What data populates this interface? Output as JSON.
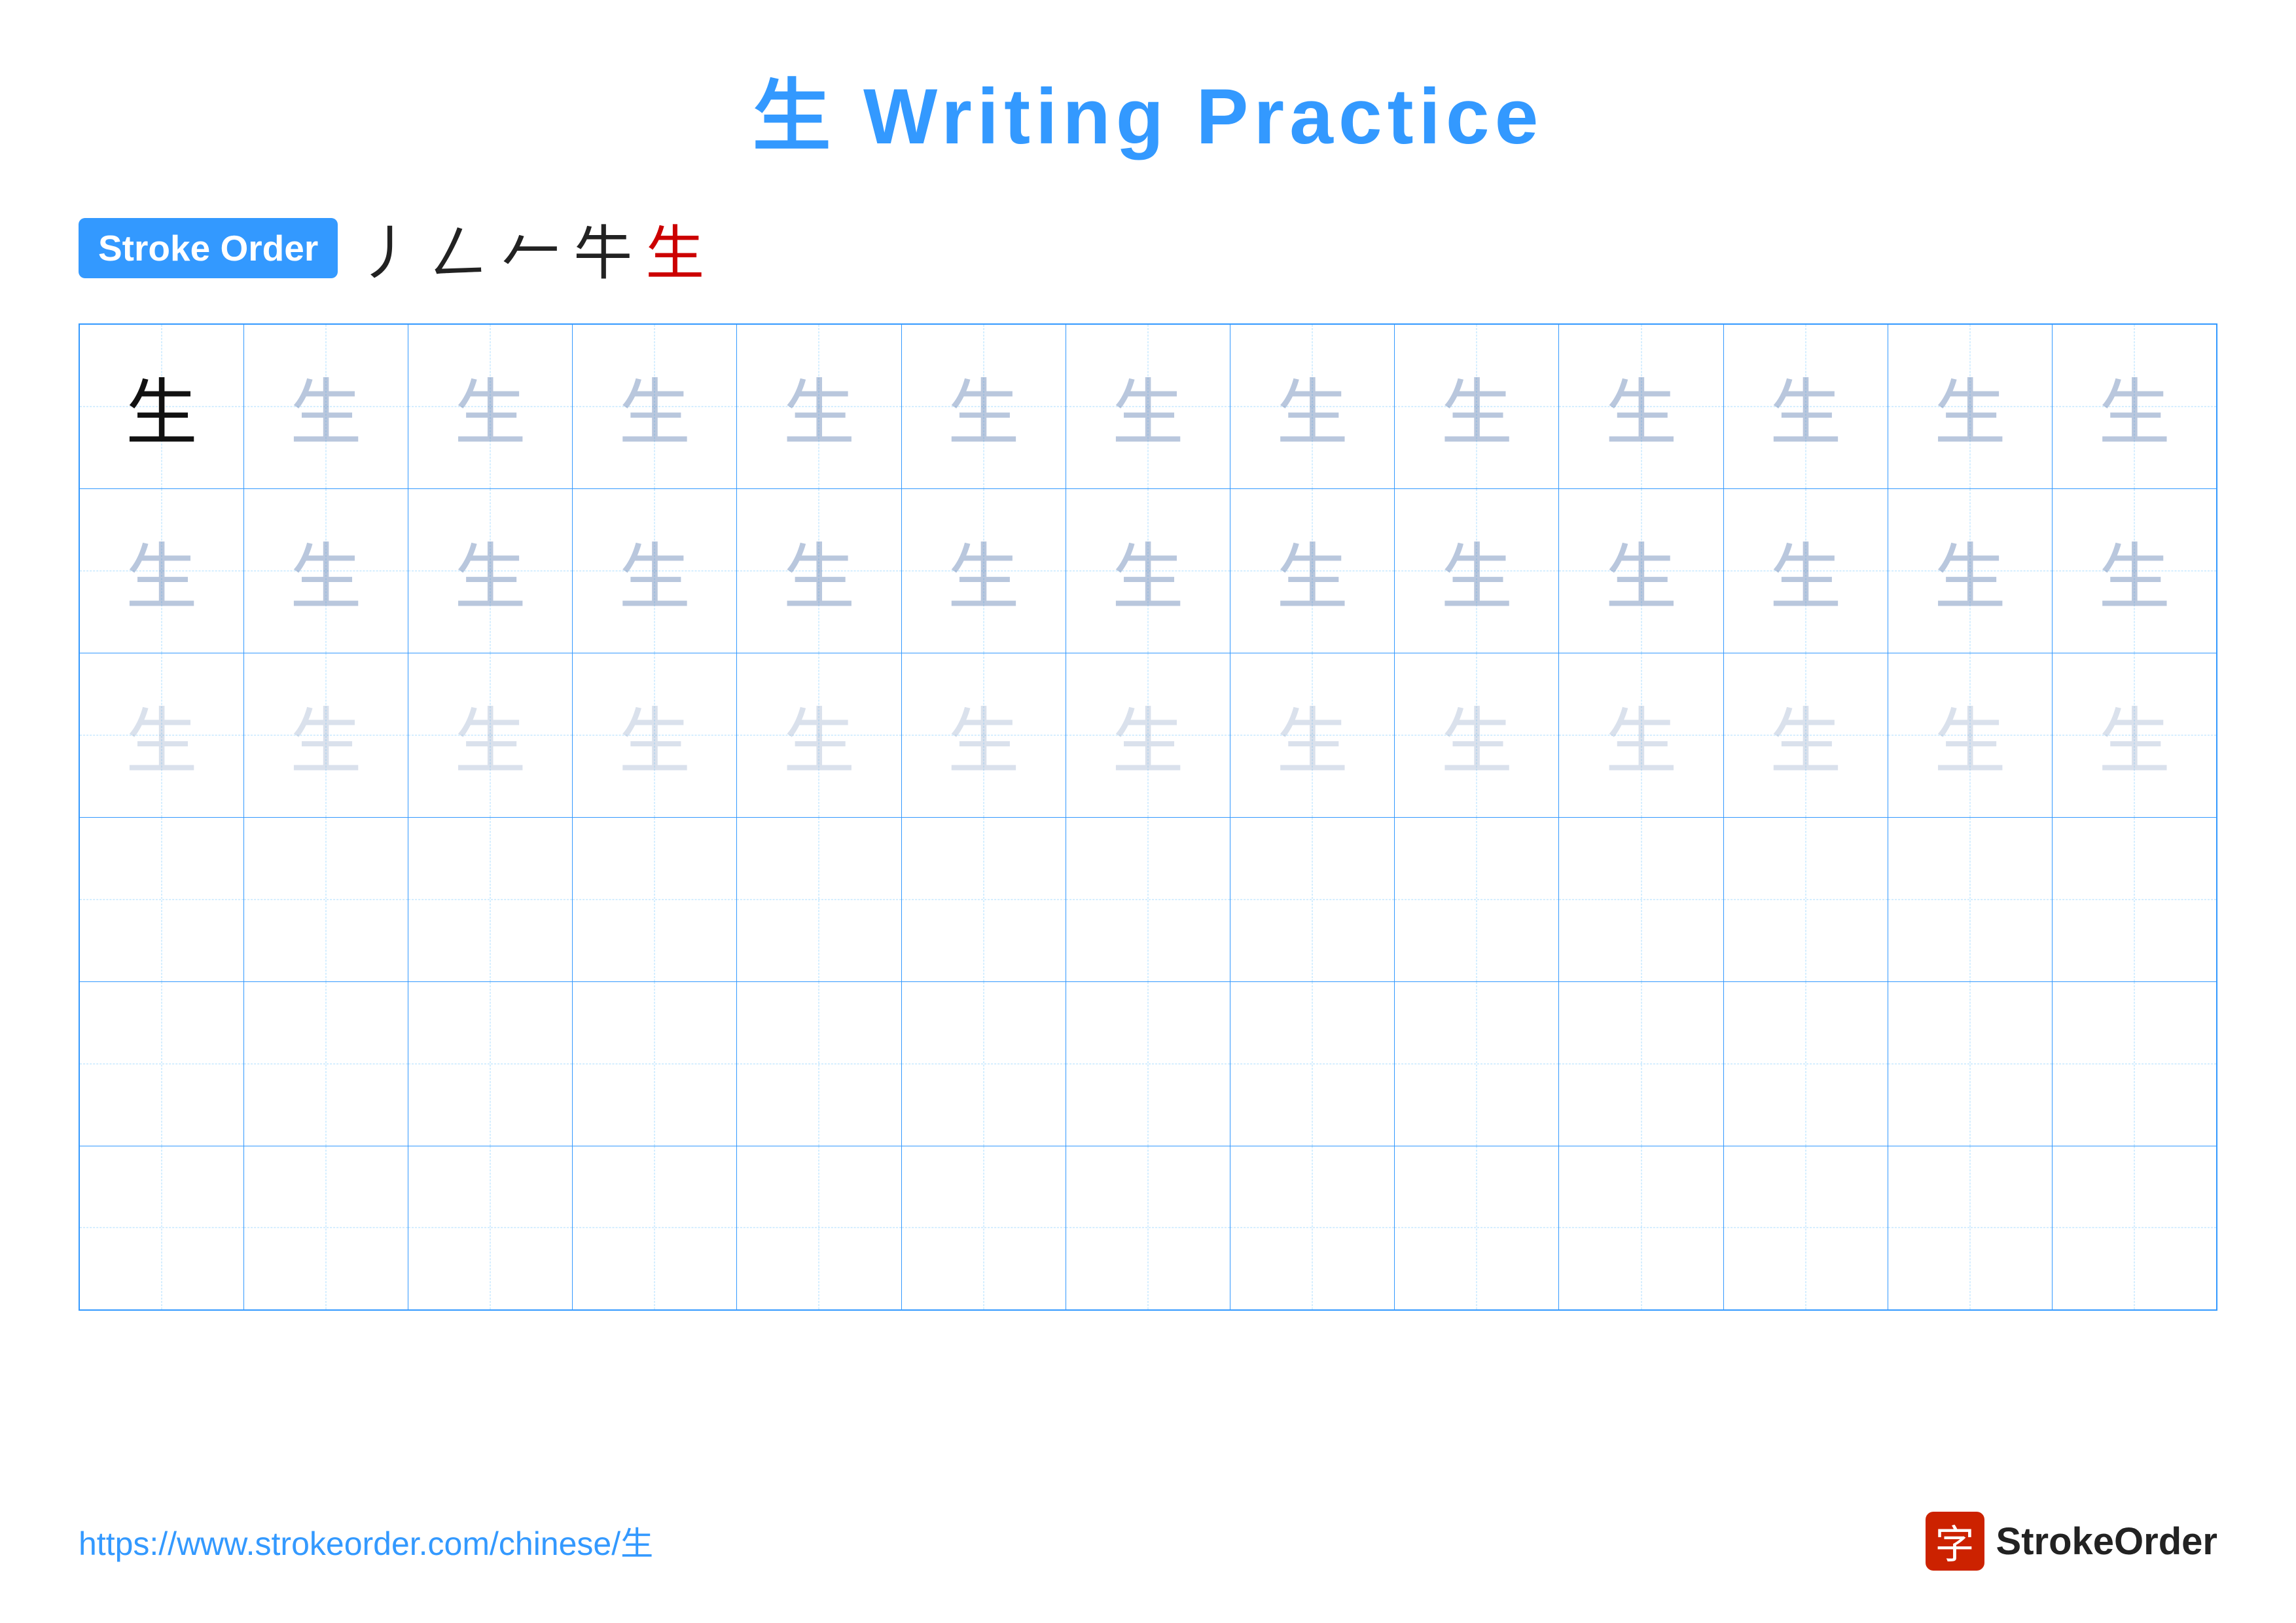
{
  "title": {
    "character": "生",
    "text": "Writing Practice",
    "full_title": "生 Writing Practice"
  },
  "stroke_order": {
    "badge_label": "Stroke Order",
    "strokes": [
      "丿",
      "一",
      "𠃊",
      "牛",
      "生"
    ],
    "stroke_colors": [
      "black",
      "black",
      "black",
      "black",
      "red"
    ]
  },
  "grid": {
    "rows": 6,
    "cols": 13,
    "character": "生",
    "row_types": [
      "model_faded",
      "faded_dark",
      "faded_light",
      "empty",
      "empty",
      "empty"
    ]
  },
  "footer": {
    "url": "https://www.strokeorder.com/chinese/生",
    "logo_char": "字",
    "logo_text": "StrokeOrder"
  }
}
